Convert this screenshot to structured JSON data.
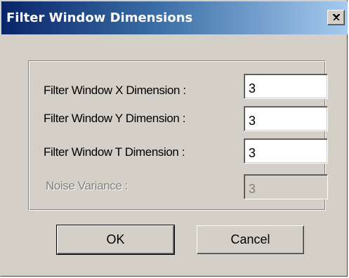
{
  "window": {
    "title": "Filter Window Dimensions",
    "close_symbol": "close-icon"
  },
  "fields": [
    {
      "label": "Filter Window X Dimension :",
      "value": "3",
      "enabled": true
    },
    {
      "label": "Filter Window Y Dimension :",
      "value": "3",
      "enabled": true
    },
    {
      "label": "Filter Window T Dimension :",
      "value": "3",
      "enabled": true
    },
    {
      "label": "Noise Variance :",
      "value": "3",
      "enabled": false
    }
  ],
  "buttons": {
    "ok_label": "OK",
    "cancel_label": "Cancel"
  },
  "colors": {
    "title_start": "#0a246a",
    "title_end": "#a6caf0",
    "face": "#d4d0c8"
  }
}
